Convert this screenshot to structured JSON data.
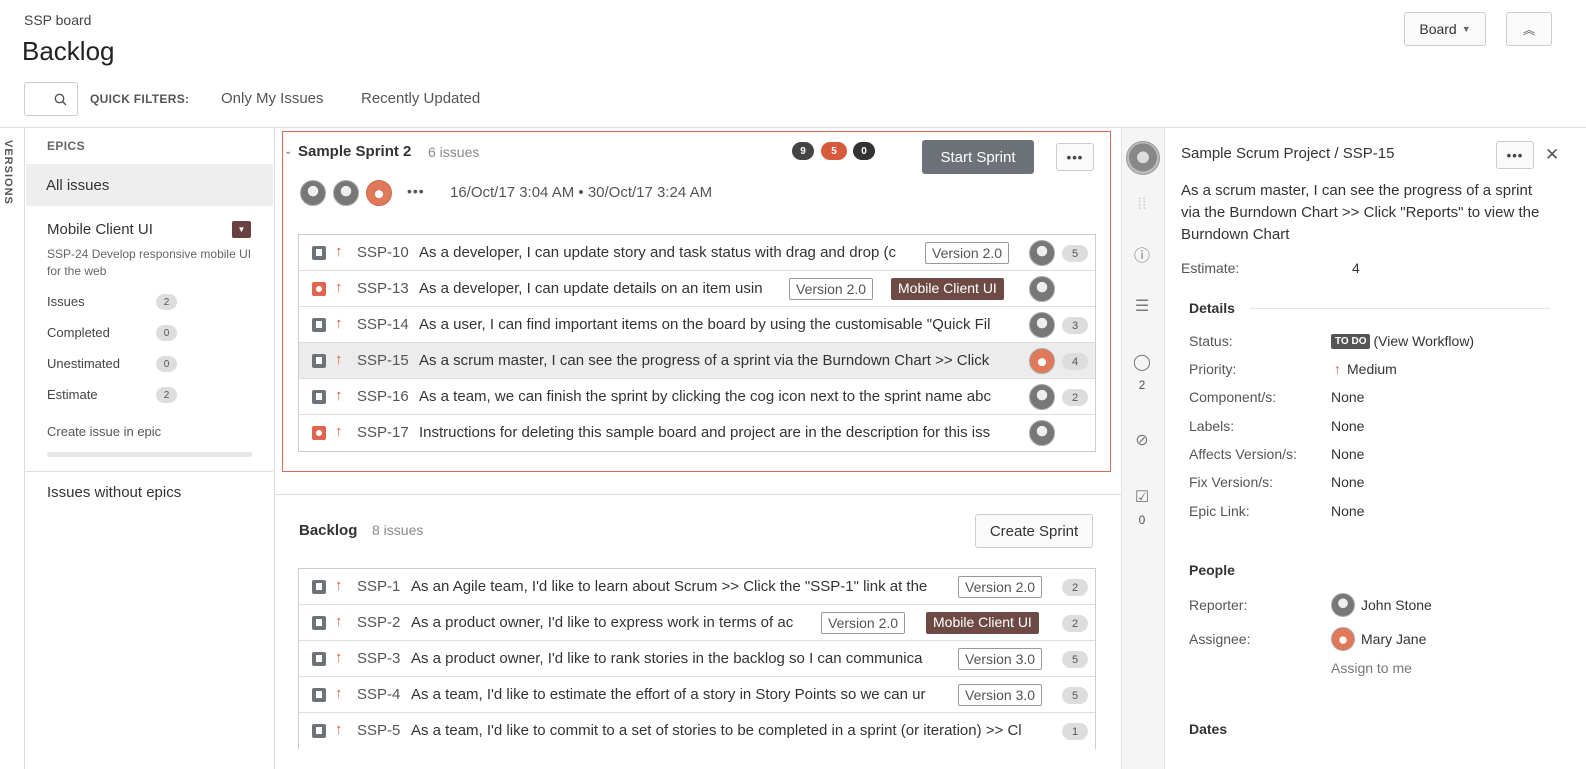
{
  "header": {
    "board_name": "SSP board",
    "title": "Backlog",
    "board_menu": "Board",
    "collapse_icon": "double-chevron-up-icon"
  },
  "filters": {
    "label": "QUICK FILTERS:",
    "items": [
      "Only My Issues",
      "Recently Updated"
    ]
  },
  "versions_tab": "VERSIONS",
  "epics": {
    "title": "EPICS",
    "all_issues": "All issues",
    "epic": {
      "name": "Mobile Client UI",
      "description": "SSP-24 Develop responsive mobile UI for the web",
      "color": "#6b4040",
      "stats": [
        {
          "label": "Issues",
          "value": "2"
        },
        {
          "label": "Completed",
          "value": "0"
        },
        {
          "label": "Unestimated",
          "value": "0"
        },
        {
          "label": "Estimate",
          "value": "2"
        }
      ],
      "create_link": "Create issue in epic"
    },
    "without_epics": "Issues without epics"
  },
  "sprint": {
    "name": "Sample Sprint 2",
    "count": "6 issues",
    "pills": [
      {
        "value": "9",
        "color": "#444"
      },
      {
        "value": "5",
        "color": "#d85a3c"
      },
      {
        "value": "0",
        "color": "#333"
      }
    ],
    "start_label": "Start Sprint",
    "more": "•••",
    "dates": "16/Oct/17 3:04 AM • 30/Oct/17 3:24 AM",
    "issues": [
      {
        "key": "SSP-10",
        "summary": "As a developer, I can update story and task status with drag and drop (c",
        "type": "story",
        "version": "Version 2.0",
        "epic": "",
        "assignee": "gray",
        "points": "5"
      },
      {
        "key": "SSP-13",
        "summary": "As a developer, I can update details on an item usin",
        "type": "bug",
        "version": "Version 2.0",
        "epic": "Mobile Client UI",
        "assignee": "gray",
        "points": ""
      },
      {
        "key": "SSP-14",
        "summary": "As a user, I can find important items on the board by using the customisable \"Quick Fil",
        "type": "story",
        "version": "",
        "epic": "",
        "assignee": "gray",
        "points": "3"
      },
      {
        "key": "SSP-15",
        "summary": "As a scrum master, I can see the progress of a sprint via the Burndown Chart >> Click",
        "type": "story",
        "version": "",
        "epic": "",
        "assignee": "orange",
        "points": "4",
        "selected": true
      },
      {
        "key": "SSP-16",
        "summary": "As a team, we can finish the sprint by clicking the cog icon next to the sprint name abc",
        "type": "story",
        "version": "",
        "epic": "",
        "assignee": "gray",
        "points": "2"
      },
      {
        "key": "SSP-17",
        "summary": "Instructions for deleting this sample board and project are in the description for this iss",
        "type": "bug",
        "version": "",
        "epic": "",
        "assignee": "gray",
        "points": ""
      }
    ]
  },
  "backlog": {
    "name": "Backlog",
    "count": "8 issues",
    "create_label": "Create Sprint",
    "issues": [
      {
        "key": "SSP-1",
        "summary": "As an Agile team, I'd like to learn about Scrum >> Click the \"SSP-1\" link at the",
        "type": "story",
        "version": "Version 2.0",
        "epic": "",
        "points": "2"
      },
      {
        "key": "SSP-2",
        "summary": "As a product owner, I'd like to express work in terms of ac",
        "type": "story",
        "version": "Version 2.0",
        "epic": "Mobile Client UI",
        "points": "2"
      },
      {
        "key": "SSP-3",
        "summary": "As a product owner, I'd like to rank stories in the backlog so I can communica",
        "type": "story",
        "version": "Version 3.0",
        "epic": "",
        "points": "5"
      },
      {
        "key": "SSP-4",
        "summary": "As a team, I'd like to estimate the effort of a story in Story Points so we can ur",
        "type": "story",
        "version": "Version 3.0",
        "epic": "",
        "points": "5"
      },
      {
        "key": "SSP-5",
        "summary": "As a team, I'd like to commit to a set of stories to be completed in a sprint (or iteration) >> Cl",
        "type": "story",
        "version": "",
        "epic": "",
        "points": "1"
      }
    ]
  },
  "detail_strip": {
    "comments_count": "2",
    "subtasks_count": "0"
  },
  "detail": {
    "project": "Sample Scrum Project",
    "separator": " / ",
    "issue_key": "SSP-15",
    "summary": "As a scrum master, I can see the progress of a sprint via the Burndown Chart >> Click \"Reports\" to view the Burndown Chart",
    "estimate_label": "Estimate:",
    "estimate": "4",
    "details_title": "Details",
    "status_label": "Status:",
    "status": "TO DO",
    "workflow_link": "(View Workflow)",
    "priority_label": "Priority:",
    "priority": "Medium",
    "fields": [
      {
        "label": "Component/s:",
        "value": "None"
      },
      {
        "label": "Labels:",
        "value": "None"
      },
      {
        "label": "Affects Version/s:",
        "value": "None"
      },
      {
        "label": "Fix Version/s:",
        "value": "None"
      },
      {
        "label": "Epic Link:",
        "value": "None"
      }
    ],
    "people_title": "People",
    "reporter_label": "Reporter:",
    "reporter": "John Stone",
    "assignee_label": "Assignee:",
    "assignee": "Mary Jane",
    "assign_to_me": "Assign to me",
    "dates_title": "Dates"
  }
}
